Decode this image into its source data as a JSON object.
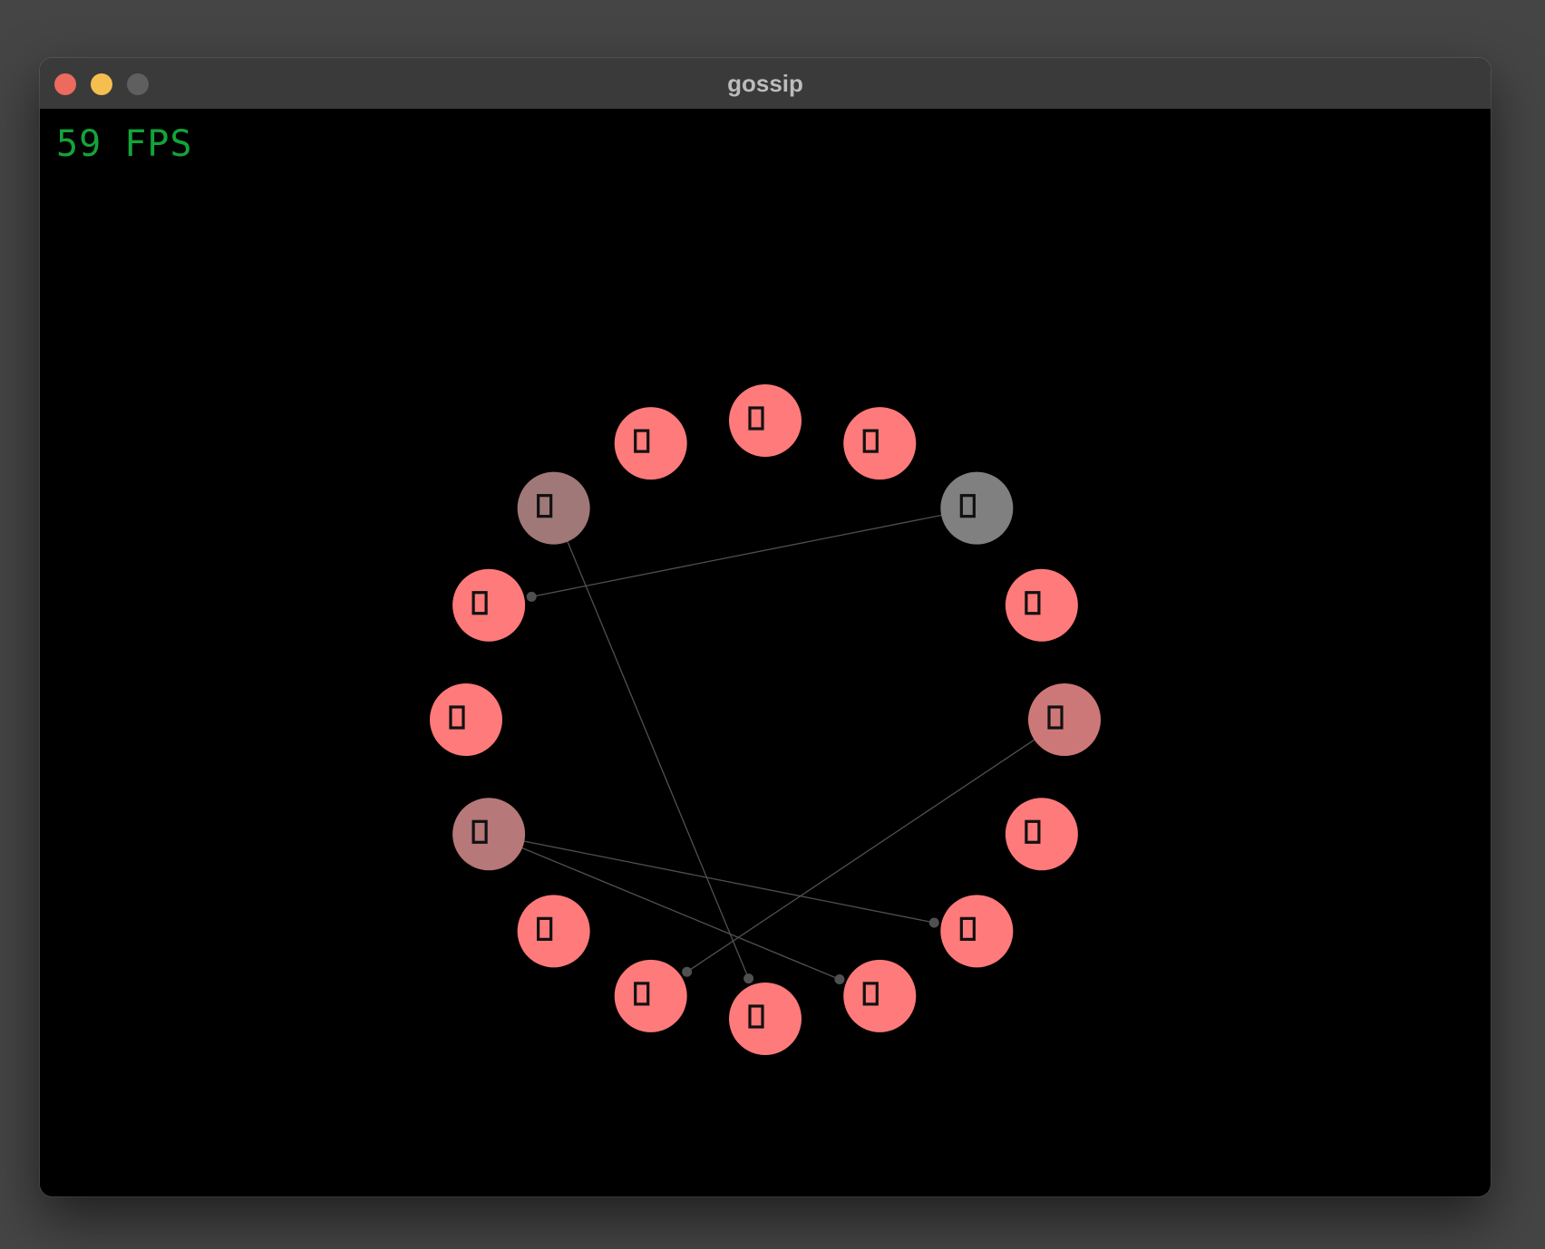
{
  "window": {
    "title": "gossip",
    "buttons": {
      "close": "close",
      "minimize": "minimize",
      "zoom": "zoom"
    }
  },
  "hud": {
    "fps_text": "59 FPS"
  },
  "colors": {
    "node_active": "#ff7a7a",
    "fps": "#14a33a",
    "edge": "#505050"
  },
  "nodes": [
    {
      "glyph": "▯",
      "color": "#ff7a7a"
    },
    {
      "glyph": "▯",
      "color": "#ff7a7a"
    },
    {
      "glyph": "▯",
      "color": "#808080"
    },
    {
      "glyph": "▯",
      "color": "#ff7a7a"
    },
    {
      "glyph": "▯",
      "color": "#cd7878"
    },
    {
      "glyph": "▯",
      "color": "#ff7a7a"
    },
    {
      "glyph": "▯",
      "color": "#ff7a7a"
    },
    {
      "glyph": "▯",
      "color": "#ff7a7a"
    },
    {
      "glyph": "▯",
      "color": "#ff7a7a"
    },
    {
      "glyph": "▯",
      "color": "#ff7a7a"
    },
    {
      "glyph": "▯",
      "color": "#ff7a7a"
    },
    {
      "glyph": "▯",
      "color": "#b67878"
    },
    {
      "glyph": "▯",
      "color": "#ff7a7a"
    },
    {
      "glyph": "▯",
      "color": "#ff7a7a"
    },
    {
      "glyph": "▯",
      "color": "#a07878"
    },
    {
      "glyph": "▯",
      "color": "#ff7a7a"
    }
  ],
  "messages": [
    {
      "from": 2,
      "to": 13
    },
    {
      "from": 4,
      "to": 9
    },
    {
      "from": 11,
      "to": 6
    },
    {
      "from": 11,
      "to": 7
    },
    {
      "from": 14,
      "to": 8
    }
  ]
}
